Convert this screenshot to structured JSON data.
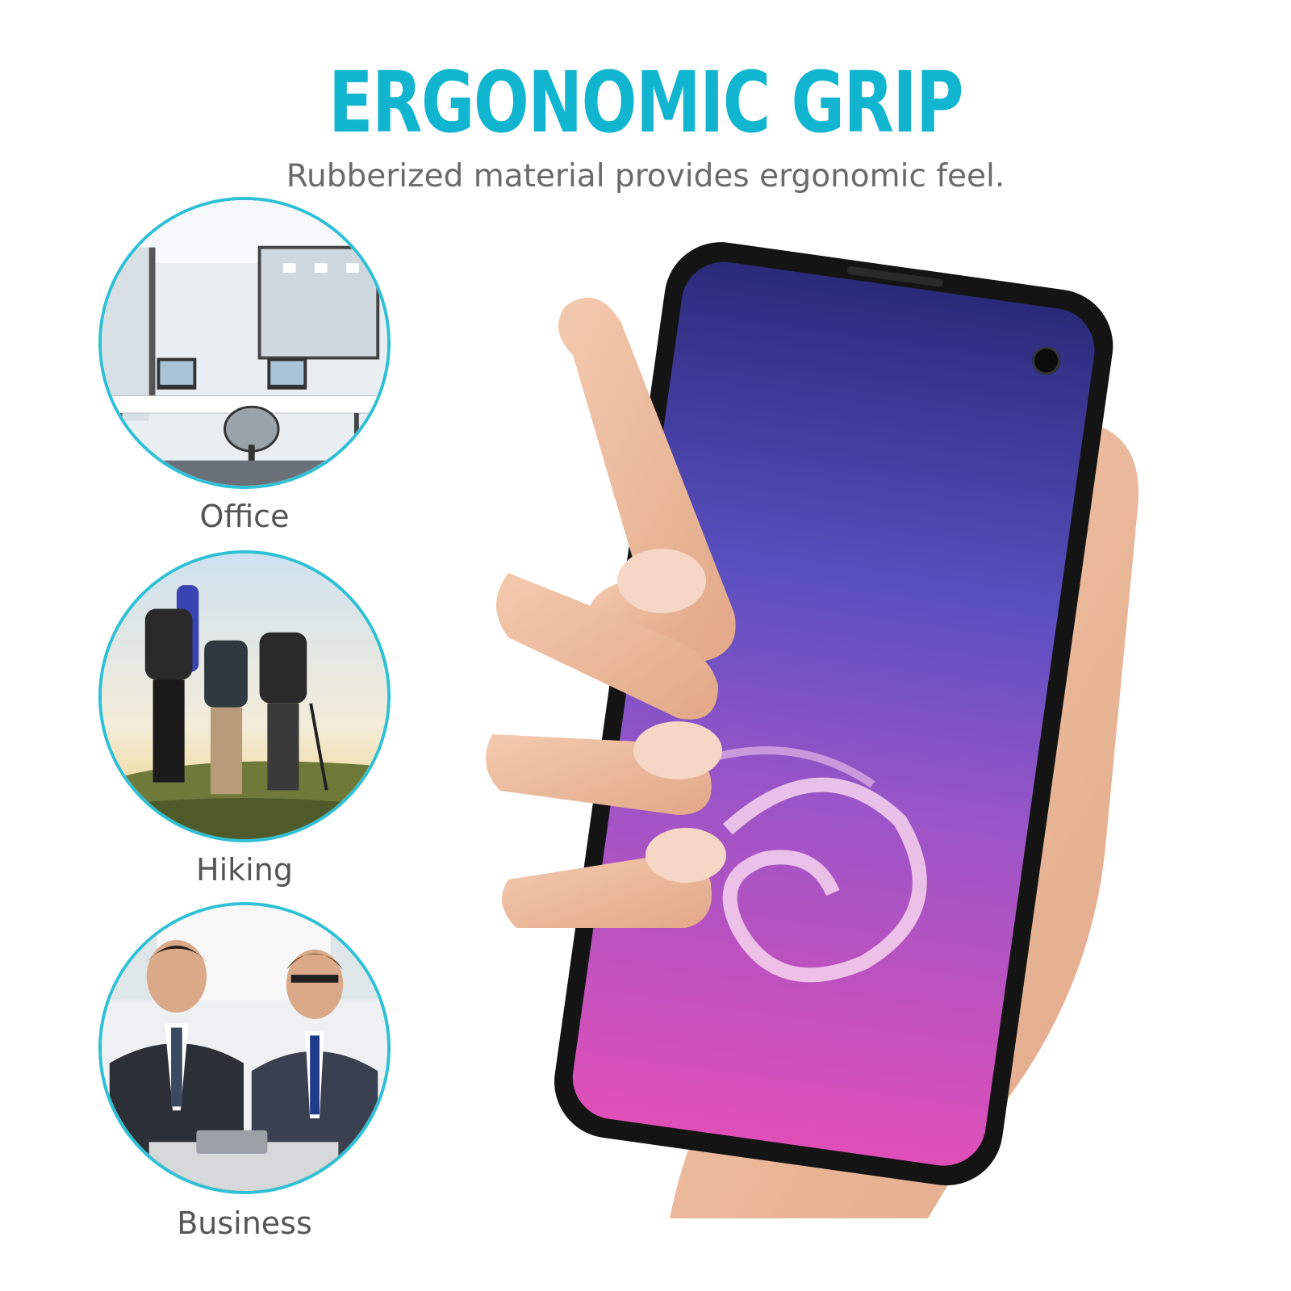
{
  "header": {
    "title": "ERGONOMIC GRIP",
    "subtitle": "Rubberized material provides ergonomic feel."
  },
  "scenes": [
    {
      "label": "Office"
    },
    {
      "label": "Hiking"
    },
    {
      "label": "Business"
    }
  ],
  "colors": {
    "accent": "#12b5cf",
    "ring": "#2fc0d6",
    "text_muted": "#6a6a6a",
    "phone_case": "#141414",
    "screen_top": "#2a2a7a",
    "screen_bottom": "#e04fb8",
    "skin": "#f0c3a6"
  }
}
